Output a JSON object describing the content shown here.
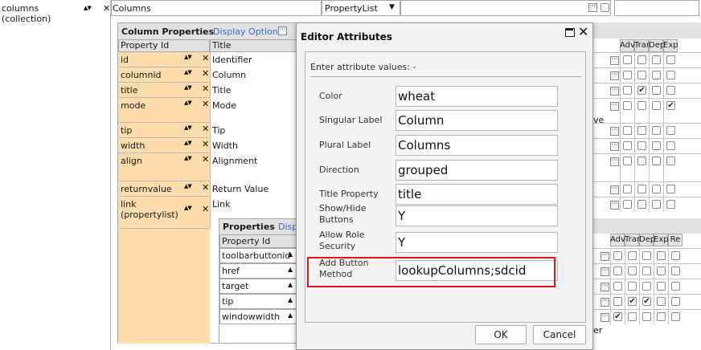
{
  "top_row": {
    "name": "columns",
    "type": "(collection)",
    "title_value": "Columns",
    "select_value": "PropertyList"
  },
  "column_properties": {
    "heading": "Column Properties",
    "display_options": "Display Options",
    "col_property_id": "Property Id",
    "col_title": "Title",
    "rows": [
      {
        "id": "id",
        "title": "Identifier"
      },
      {
        "id": "columnid",
        "title": "Column"
      },
      {
        "id": "title",
        "title": "Title"
      },
      {
        "id": "mode",
        "title": "Mode"
      },
      {
        "id": "tip",
        "title": "Tip"
      },
      {
        "id": "width",
        "title": "Width"
      },
      {
        "id": "align",
        "title": "Alignment"
      },
      {
        "id": "returnvalue",
        "title": "Return Value"
      },
      {
        "id": "link",
        "sub": "(propertylist)",
        "title": "Link"
      }
    ]
  },
  "right_headers_1": [
    "Adv",
    "Trans",
    "Dep",
    "Expr"
  ],
  "right_headers_2": [
    "Adv",
    "Trans",
    "Dep",
    "Expr",
    "Re"
  ],
  "truncated_1": "ve",
  "truncated_2": "er",
  "inner_properties": {
    "heading": "Properties",
    "display": "Disp",
    "col_property_id": "Property Id",
    "rows": [
      "toolbarbuttonid",
      "href",
      "target",
      "tip",
      "windowwidth"
    ]
  },
  "dialog": {
    "title": "Editor Attributes",
    "prompt": "Enter attribute values: -",
    "fields": [
      {
        "label": "Color",
        "value": "wheat"
      },
      {
        "label": "Singular Label",
        "value": "Column"
      },
      {
        "label": "Plural Label",
        "value": "Columns"
      },
      {
        "label": "Direction",
        "value": "grouped"
      },
      {
        "label": "Title Property",
        "value": "title"
      },
      {
        "label": "Show/Hide Buttons",
        "value": "Y"
      },
      {
        "label": "Allow Role Security",
        "value": "Y"
      },
      {
        "label": "Add Button Method",
        "value": "lookupColumns;sdcid"
      }
    ],
    "ok": "OK",
    "cancel": "Cancel",
    "highlight_color": "#e0141e"
  }
}
